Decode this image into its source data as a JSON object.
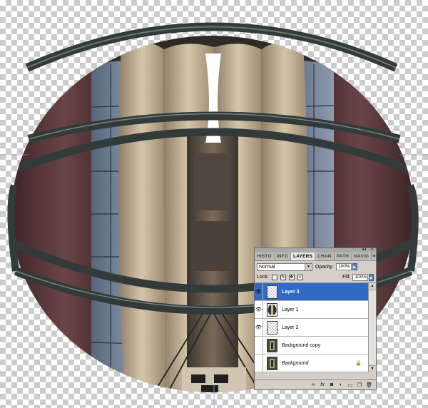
{
  "colors": {
    "selection": "#316ac5",
    "brick": "#5e3a3a",
    "concrete": "#c9b89a",
    "steel": "#3c4545",
    "glass": "#6f7f90"
  },
  "layers_panel": {
    "tabs": [
      "HISTO",
      "INFO",
      "LAYERS",
      "CHAN",
      "PATH",
      "NAVIG"
    ],
    "active_tab": "LAYERS",
    "blend_mode": "Normal",
    "opacity_label": "Opacity:",
    "opacity_value": "100%",
    "lock_label": "Lock:",
    "fill_label": "Fill:",
    "fill_value": "100%",
    "layers": [
      {
        "name": "Layer 3",
        "visible": true,
        "selected": true,
        "thumb": "checker"
      },
      {
        "name": "Layer 1",
        "visible": true,
        "selected": false,
        "thumb": "sphere"
      },
      {
        "name": "Layer 2",
        "visible": true,
        "selected": false,
        "thumb": "checker"
      },
      {
        "name": "Background copy",
        "visible": false,
        "selected": false,
        "thumb": "photo"
      },
      {
        "name": "Background",
        "visible": false,
        "selected": false,
        "thumb": "photo",
        "locked": true
      }
    ],
    "bottom_icons": [
      "link-icon",
      "fx-icon",
      "mask-icon",
      "adjustment-icon",
      "folder-icon",
      "new-layer-icon",
      "trash-icon"
    ]
  }
}
